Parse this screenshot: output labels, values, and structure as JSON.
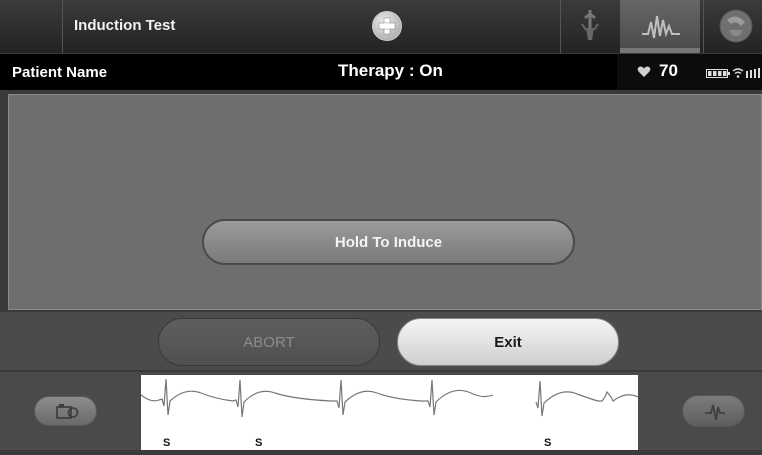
{
  "header": {
    "title": "Induction Test"
  },
  "status": {
    "patient_name": "Patient Name",
    "therapy": "Therapy : On",
    "heart_rate": "70"
  },
  "main": {
    "hold_button": "Hold To Induce"
  },
  "actions": {
    "abort": "ABORT",
    "exit": "Exit"
  },
  "ecg": {
    "beat_markers": [
      "S",
      "S",
      "S"
    ]
  },
  "icons": {
    "plus": "plus-circle-icon",
    "tool_1": "wand-icon",
    "tool_2": "waveform-icon",
    "tool_3": "magnet-icon",
    "heart": "heart-icon",
    "battery": "battery-icon",
    "wifi": "wifi-icon",
    "signal": "signal-icon"
  }
}
